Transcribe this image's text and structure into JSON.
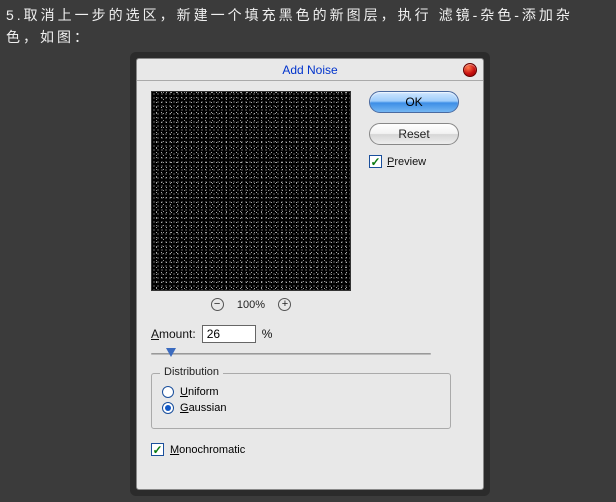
{
  "instruction": "5.取消上一步的选区，新建一个填充黑色的新图层，执行 滤镜-杂色-添加杂色，如图：",
  "dialog": {
    "title": "Add Noise",
    "ok_label": "OK",
    "reset_label": "Reset",
    "preview_label": "Preview",
    "preview_checked": true,
    "zoom": {
      "minus": "−",
      "plus": "+",
      "percent": "100%"
    },
    "amount": {
      "label": "Amount:",
      "value": "26",
      "unit": "%",
      "slider_position_pct": 7
    },
    "distribution": {
      "legend": "Distribution",
      "options": [
        {
          "label": "Uniform",
          "selected": false
        },
        {
          "label": "Gaussian",
          "selected": true
        }
      ]
    },
    "monochromatic": {
      "label": "Monochromatic",
      "checked": true
    }
  }
}
